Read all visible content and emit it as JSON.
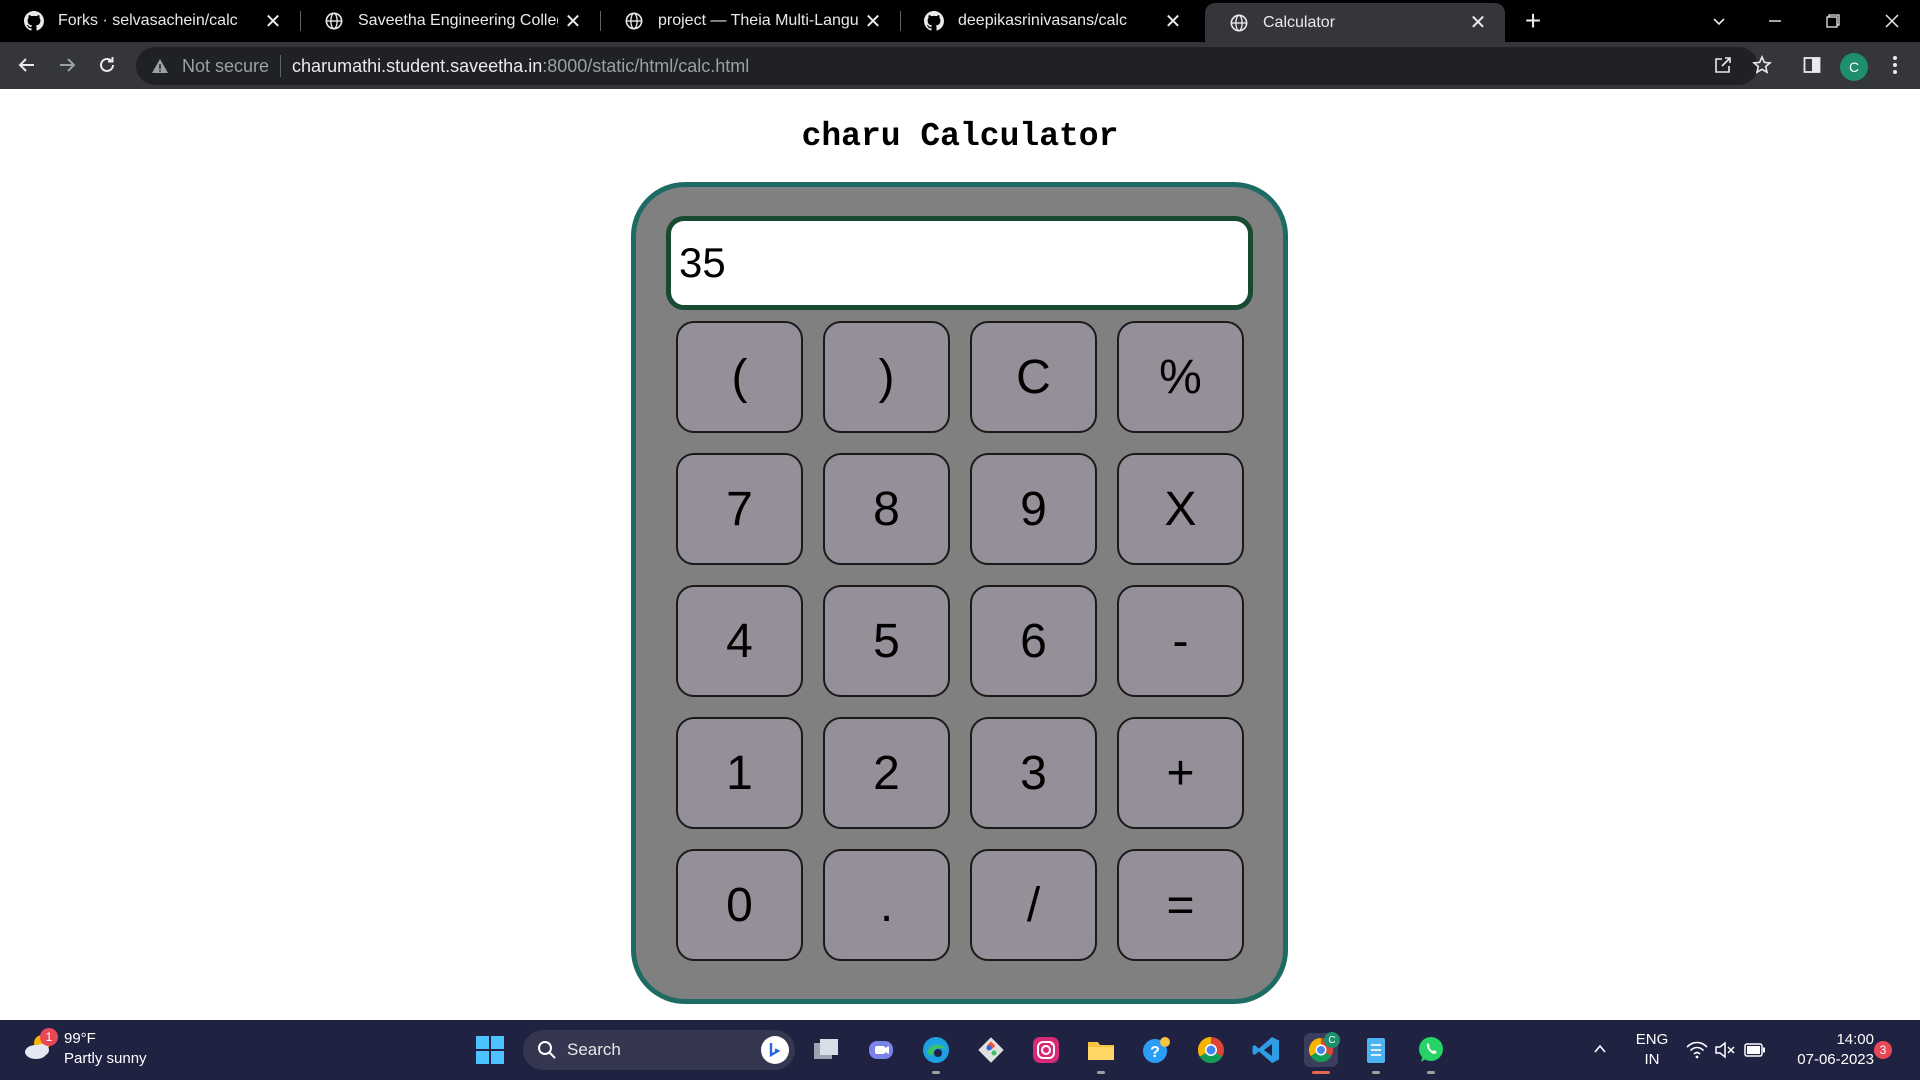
{
  "browser": {
    "tabs": [
      {
        "title": "Forks · selvasachein/calc",
        "icon": "github-icon",
        "active": false
      },
      {
        "title": "Saveetha Engineering College",
        "icon": "globe-icon",
        "active": false
      },
      {
        "title": "project — Theia Multi-Language",
        "icon": "globe-icon",
        "active": false
      },
      {
        "title": "deepikasrinivasans/calc",
        "icon": "github-icon",
        "active": false
      },
      {
        "title": "Calculator",
        "icon": "globe-icon",
        "active": true
      }
    ],
    "security_label": "Not secure",
    "url_host": "charumathi.student.saveetha.in",
    "url_rest": ":8000/static/html/calc.html",
    "profile_initial": "C"
  },
  "page": {
    "title": "charu Calculator",
    "display_value": "35",
    "keys": [
      {
        "label": "(",
        "name": "open-paren"
      },
      {
        "label": ")",
        "name": "close-paren"
      },
      {
        "label": "C",
        "name": "clear"
      },
      {
        "label": "%",
        "name": "percent"
      },
      {
        "label": "7",
        "name": "7"
      },
      {
        "label": "8",
        "name": "8"
      },
      {
        "label": "9",
        "name": "9"
      },
      {
        "label": "X",
        "name": "multiply"
      },
      {
        "label": "4",
        "name": "4"
      },
      {
        "label": "5",
        "name": "5"
      },
      {
        "label": "6",
        "name": "6"
      },
      {
        "label": "-",
        "name": "minus"
      },
      {
        "label": "1",
        "name": "1"
      },
      {
        "label": "2",
        "name": "2"
      },
      {
        "label": "3",
        "name": "3"
      },
      {
        "label": "+",
        "name": "plus"
      },
      {
        "label": "0",
        "name": "0"
      },
      {
        "label": ".",
        "name": "decimal"
      },
      {
        "label": "/",
        "name": "divide"
      },
      {
        "label": "=",
        "name": "equals"
      }
    ],
    "colors": {
      "calc_body": "#808080",
      "calc_border": "#1d6b63",
      "display_border": "#174a30",
      "key_fill": "#958f9a"
    }
  },
  "taskbar": {
    "weather_temp": "99°F",
    "weather_desc": "Partly sunny",
    "weather_badge": "1",
    "search_label": "Search",
    "lang_top": "ENG",
    "lang_bottom": "IN",
    "time": "14:00",
    "date": "07-06-2023",
    "notification_count": "3",
    "profile_initial": "C"
  }
}
